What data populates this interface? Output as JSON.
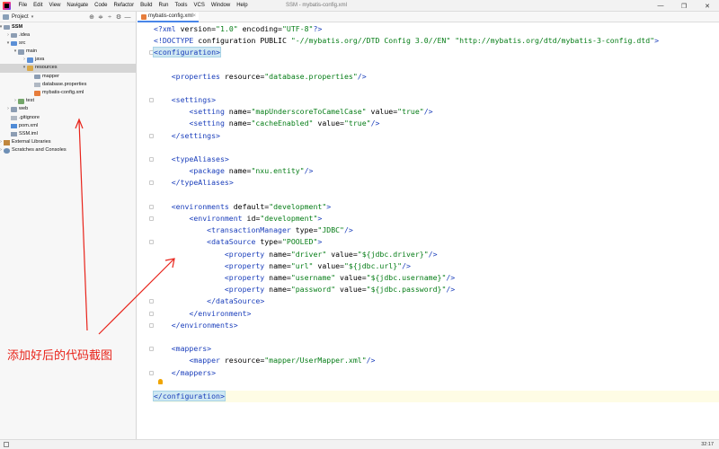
{
  "menubar": {
    "items": [
      "File",
      "Edit",
      "View",
      "Navigate",
      "Code",
      "Refactor",
      "Build",
      "Run",
      "Tools",
      "VCS",
      "Window",
      "Help"
    ],
    "window_title": "SSM - mybatis-config.xml",
    "controls": [
      "—",
      "❐",
      "✕"
    ]
  },
  "project_panel": {
    "title": "Project",
    "caret": "▾",
    "tools": [
      "⊕",
      "≑",
      "÷",
      "⚙",
      "—"
    ],
    "tree": [
      {
        "label": "SSM",
        "arrow": "▾"
      },
      {
        "label": ".idea",
        "arrow": "›"
      },
      {
        "label": "src",
        "arrow": "▾"
      },
      {
        "label": "main",
        "arrow": "▾"
      },
      {
        "label": "java",
        "arrow": "›"
      },
      {
        "label": "resources",
        "arrow": "▾"
      },
      {
        "label": "mapper",
        "arrow": ""
      },
      {
        "label": "database.properties",
        "arrow": ""
      },
      {
        "label": "mybatis-config.xml",
        "arrow": ""
      },
      {
        "label": "test",
        "arrow": "›"
      },
      {
        "label": "web",
        "arrow": "›"
      },
      {
        "label": ".gitignore",
        "arrow": ""
      },
      {
        "label": "pom.xml",
        "arrow": ""
      },
      {
        "label": "SSM.iml",
        "arrow": ""
      },
      {
        "label": "External Libraries",
        "arrow": "›"
      },
      {
        "label": "Scratches and Consoles",
        "arrow": "›"
      }
    ]
  },
  "editor": {
    "tab_label": "mybatis-config.xml",
    "tab_close": "×",
    "lines": [
      "<?xml version=\"1.0\" encoding=\"UTF-8\"?>",
      "<!DOCTYPE configuration PUBLIC \"-//mybatis.org//DTD Config 3.0//EN\" \"http://mybatis.org/dtd/mybatis-3-config.dtd\">",
      "<configuration>",
      "",
      "    <properties resource=\"database.properties\"/>",
      "",
      "    <settings>",
      "        <setting name=\"mapUnderscoreToCamelCase\" value=\"true\"/>",
      "        <setting name=\"cacheEnabled\" value=\"true\"/>",
      "    </settings>",
      "",
      "    <typeAliases>",
      "        <package name=\"nxu.entity\"/>",
      "    </typeAliases>",
      "",
      "    <environments default=\"development\">",
      "        <environment id=\"development\">",
      "            <transactionManager type=\"JDBC\"/>",
      "            <dataSource type=\"POOLED\">",
      "                <property name=\"driver\" value=\"${jdbc.driver}\"/>",
      "                <property name=\"url\" value=\"${jdbc.url}\"/>",
      "                <property name=\"username\" value=\"${jdbc.username}\"/>",
      "                <property name=\"password\" value=\"${jdbc.password}\"/>",
      "            </dataSource>",
      "        </environment>",
      "    </environments>",
      "",
      "    <mappers>",
      "        <mapper resource=\"mapper/UserMapper.xml\"/>",
      "    </mappers>",
      "",
      "</configuration>"
    ]
  },
  "annotation": {
    "label": "添加好后的代码截图",
    "color": "#e8231a"
  },
  "statusbar": {
    "position": "32:17"
  }
}
